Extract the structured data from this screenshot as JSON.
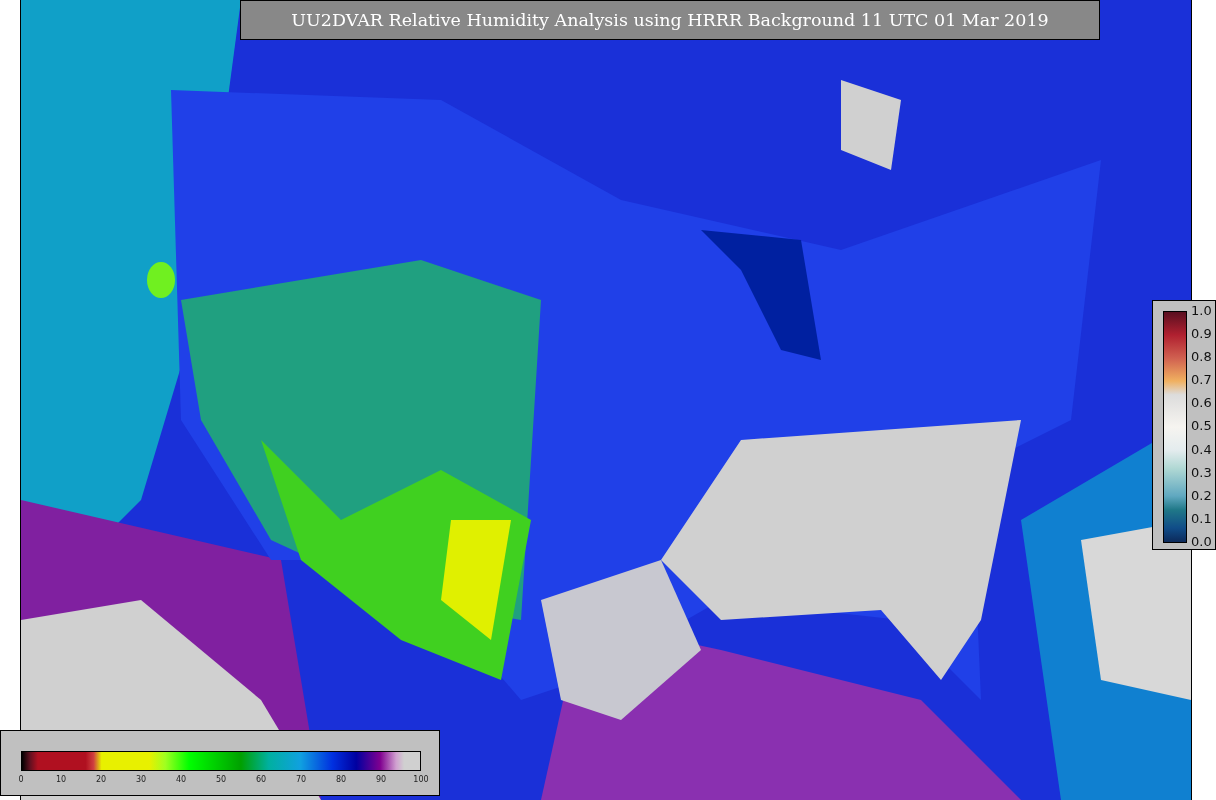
{
  "title": "UU2DVAR Relative Humidity Analysis using HRRR Background 11 UTC 01 Mar 2019",
  "humidity_colorbar": {
    "ticks": [
      "0",
      "10",
      "20",
      "30",
      "40",
      "50",
      "60",
      "70",
      "80",
      "90",
      "100"
    ]
  },
  "station_colorbar": {
    "ticks": [
      "1.0",
      "0.9",
      "0.8",
      "0.7",
      "0.6",
      "0.5",
      "0.4",
      "0.3",
      "0.2",
      "0.1",
      "0.0"
    ]
  }
}
